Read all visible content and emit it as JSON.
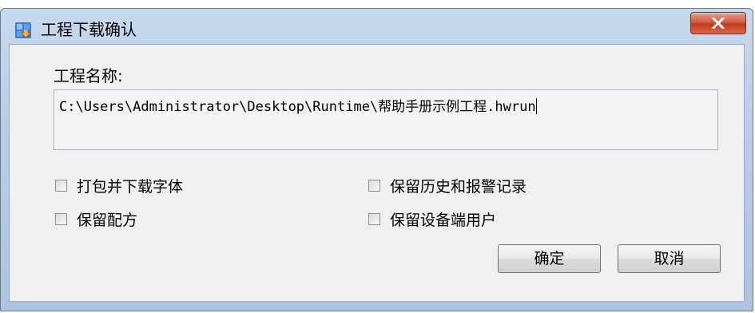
{
  "window": {
    "title": "工程下载确认"
  },
  "form": {
    "name_label": "工程名称:",
    "project_path": "C:\\Users\\Administrator\\Desktop\\Runtime\\帮助手册示例工程.hwrun"
  },
  "options": [
    {
      "label": "打包并下载字体",
      "checked": false
    },
    {
      "label": "保留历史和报警记录",
      "checked": false
    },
    {
      "label": "保留配方",
      "checked": false
    },
    {
      "label": "保留设备端用户",
      "checked": false
    }
  ],
  "buttons": {
    "ok": "确定",
    "cancel": "取消"
  },
  "icons": {
    "close": "close-icon",
    "app": "app-icon"
  },
  "colors": {
    "close_button": "#c9432a",
    "title_bar": "#bfd3ea"
  }
}
